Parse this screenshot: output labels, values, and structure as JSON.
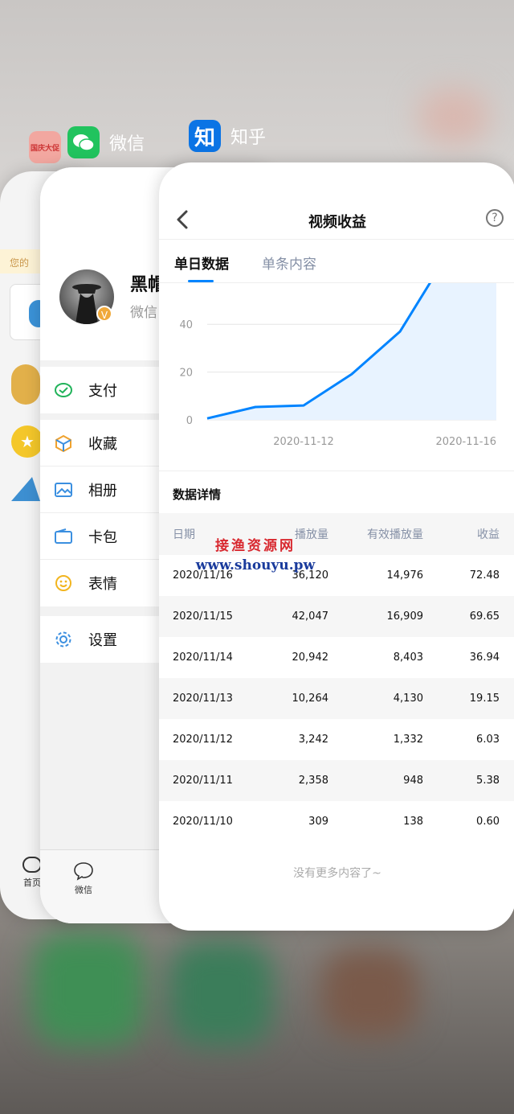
{
  "switcher": {
    "apps": [
      {
        "name": "微信",
        "icon": "wechat-icon"
      },
      {
        "name": "知乎",
        "icon": "zhihu-icon",
        "icon_text": "知"
      }
    ],
    "back_card": {
      "icon_label": "国庆大促",
      "banner_text": "您的",
      "tab_label": "首页"
    }
  },
  "wechat": {
    "profile_name": "黑帽",
    "profile_sub": "微信",
    "badge": "V",
    "menu": [
      {
        "label": "支付",
        "icon": "wechat-pay-icon"
      },
      {
        "label": "收藏",
        "icon": "favorites-cube-icon"
      },
      {
        "label": "相册",
        "icon": "album-icon"
      },
      {
        "label": "卡包",
        "icon": "card-wallet-icon"
      },
      {
        "label": "表情",
        "icon": "emoji-icon"
      },
      {
        "label": "设置",
        "icon": "settings-gear-icon"
      }
    ],
    "tabbar": {
      "label": "微信"
    }
  },
  "zhihu": {
    "title": "视频收益",
    "back": "‹",
    "help": "?",
    "tabs": [
      {
        "label": "单日数据",
        "active": true
      },
      {
        "label": "单条内容",
        "active": false
      }
    ],
    "section_title": "数据详情",
    "table": {
      "headers": [
        "日期",
        "播放量",
        "有效播放量",
        "收益"
      ],
      "rows": [
        [
          "2020/11/16",
          "36,120",
          "14,976",
          "72.48"
        ],
        [
          "2020/11/15",
          "42,047",
          "16,909",
          "69.65"
        ],
        [
          "2020/11/14",
          "20,942",
          "8,403",
          "36.94"
        ],
        [
          "2020/11/13",
          "10,264",
          "4,130",
          "19.15"
        ],
        [
          "2020/11/12",
          "3,242",
          "1,332",
          "6.03"
        ],
        [
          "2020/11/11",
          "2,358",
          "948",
          "5.38"
        ],
        [
          "2020/11/10",
          "309",
          "138",
          "0.60"
        ]
      ]
    },
    "footer": "没有更多内容了~",
    "accent": "#0084ff"
  },
  "chart_data": {
    "type": "area",
    "x": [
      "2020-11-10",
      "2020-11-11",
      "2020-11-12",
      "2020-11-13",
      "2020-11-14",
      "2020-11-15",
      "2020-11-16"
    ],
    "values": [
      0.6,
      5.38,
      6.03,
      19.15,
      36.94,
      69.65,
      72.48
    ],
    "yticks": [
      0,
      20,
      40
    ],
    "xticks": [
      "2020-11-12",
      "2020-11-16"
    ],
    "ylim": [
      0,
      60
    ],
    "grid": true,
    "color": "#0084ff",
    "fill": "#e8f3ff"
  },
  "watermark": {
    "line1": "接渔资源网",
    "line2": "www.shouyu.pw"
  }
}
